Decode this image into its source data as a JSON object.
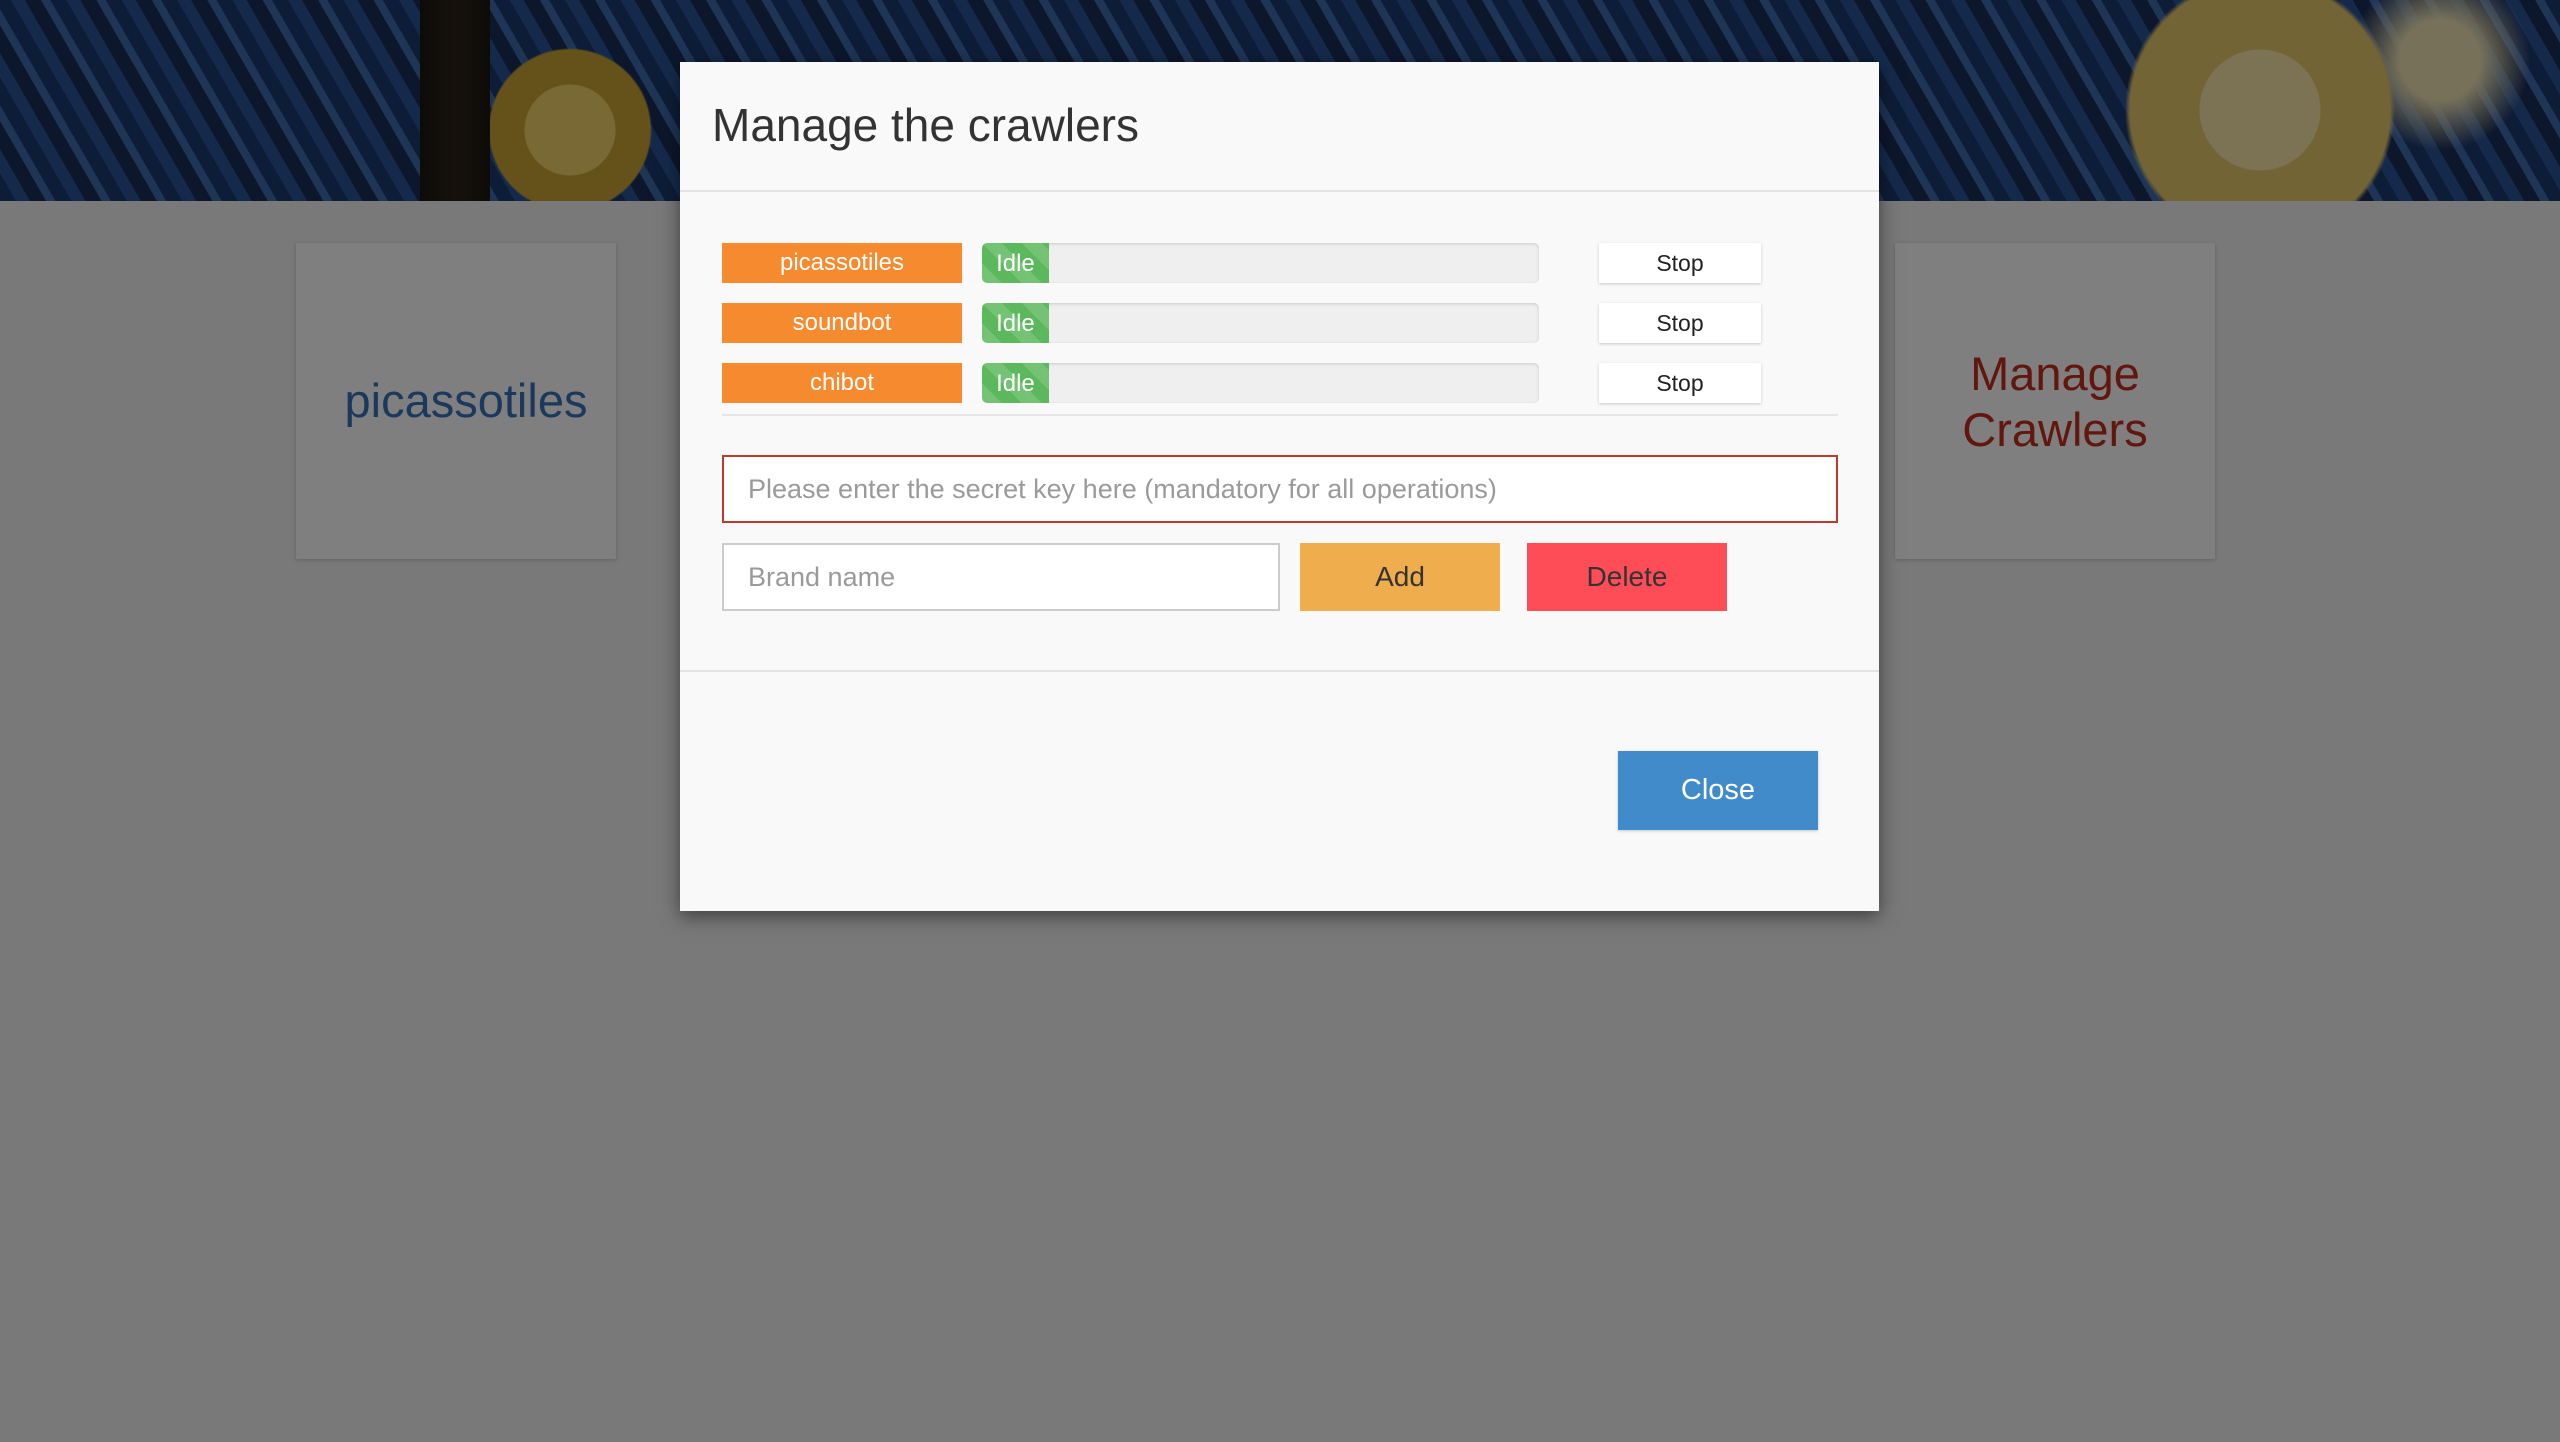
{
  "background": {
    "cards": [
      {
        "title": "picassotiles"
      },
      {
        "title": "Manage Crawlers"
      }
    ]
  },
  "modal": {
    "title": "Manage the crawlers",
    "crawlers": [
      {
        "name": "picassotiles",
        "status": "Idle",
        "progress_fraction": 0.12,
        "stop_label": "Stop"
      },
      {
        "name": "soundbot",
        "status": "Idle",
        "progress_fraction": 0.12,
        "stop_label": "Stop"
      },
      {
        "name": "chibot",
        "status": "Idle",
        "progress_fraction": 0.12,
        "stop_label": "Stop"
      }
    ],
    "secret_key": {
      "value": "",
      "placeholder": "Please enter the secret key here (mandatory for all operations)"
    },
    "brand_name": {
      "value": "",
      "placeholder": "Brand name"
    },
    "add_label": "Add",
    "delete_label": "Delete",
    "close_label": "Close"
  },
  "colors": {
    "crawler_badge": "#f58a2f",
    "progress_fill": "#5cb85c",
    "add_button": "#f0ad4e",
    "delete_button": "#ff4d57",
    "close_button": "#428bca",
    "secret_border": "#c0392b"
  }
}
